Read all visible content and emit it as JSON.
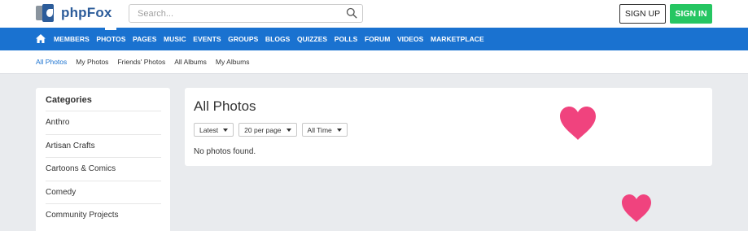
{
  "header": {
    "logo_text": "phpFox",
    "search_placeholder": "Search...",
    "signup_label": "SIGN UP",
    "signin_label": "SIGN IN"
  },
  "main_nav": {
    "items": [
      {
        "label": "MEMBERS"
      },
      {
        "label": "PHOTOS",
        "active": true
      },
      {
        "label": "PAGES"
      },
      {
        "label": "MUSIC"
      },
      {
        "label": "EVENTS"
      },
      {
        "label": "GROUPS"
      },
      {
        "label": "BLOGS"
      },
      {
        "label": "QUIZZES"
      },
      {
        "label": "POLLS"
      },
      {
        "label": "FORUM"
      },
      {
        "label": "VIDEOS"
      },
      {
        "label": "MARKETPLACE"
      }
    ]
  },
  "sub_nav": {
    "items": [
      {
        "label": "All Photos",
        "active": true
      },
      {
        "label": "My Photos"
      },
      {
        "label": "Friends' Photos"
      },
      {
        "label": "All Albums"
      },
      {
        "label": "My Albums"
      }
    ]
  },
  "sidebar": {
    "title": "Categories",
    "items": [
      "Anthro",
      "Artisan Crafts",
      "Cartoons & Comics",
      "Comedy",
      "Community Projects"
    ]
  },
  "content": {
    "title": "All Photos",
    "filters": {
      "sort": "Latest",
      "per_page": "20 per page",
      "time": "All Time"
    },
    "empty_message": "No photos found."
  },
  "colors": {
    "brand_blue": "#1a72d0",
    "signin_green": "#26c662",
    "heart_pink": "#f0437e"
  }
}
